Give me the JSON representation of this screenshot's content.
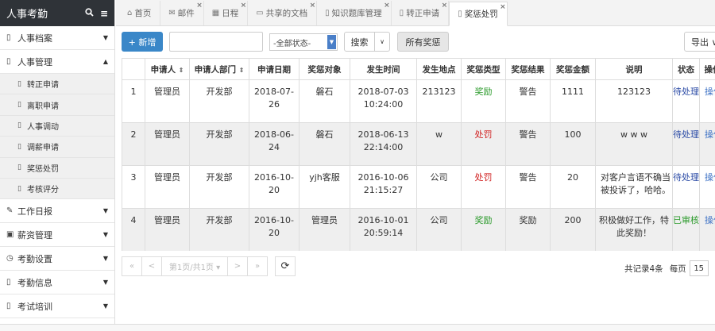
{
  "sidebar": {
    "title": "人事考勤",
    "search_icon": "search-icon",
    "menu_icon": "menu-icon",
    "items": [
      {
        "label": "人事档案",
        "icon": "bookmark-icon",
        "glyph": "▯",
        "caret": "▼"
      },
      {
        "label": "人事管理",
        "icon": "bookmark-icon",
        "glyph": "▯",
        "caret": "▲"
      },
      {
        "label": "工作日报",
        "icon": "edit-icon",
        "glyph": "✎",
        "caret": "▼"
      },
      {
        "label": "薪资管理",
        "icon": "money-icon",
        "glyph": "▣",
        "caret": "▼"
      },
      {
        "label": "考勤设置",
        "icon": "clock-icon",
        "glyph": "◷",
        "caret": "▼"
      },
      {
        "label": "考勤信息",
        "icon": "bookmark-icon",
        "glyph": "▯",
        "caret": "▼"
      },
      {
        "label": "考试培训",
        "icon": "bookmark-icon",
        "glyph": "▯",
        "caret": "▼"
      }
    ],
    "subitems": [
      "转正申请",
      "离职申请",
      "人事调动",
      "调薪申请",
      "奖惩处罚",
      "考核评分"
    ]
  },
  "tabs": [
    {
      "label": "首页",
      "glyph": "⌂"
    },
    {
      "label": "邮件",
      "glyph": "✉"
    },
    {
      "label": "日程",
      "glyph": "▦"
    },
    {
      "label": "共享的文档",
      "glyph": "▭"
    },
    {
      "label": "知识题库管理",
      "glyph": "▯"
    },
    {
      "label": "转正申请",
      "glyph": "▯"
    },
    {
      "label": "奖惩处罚",
      "glyph": "▯"
    }
  ],
  "toolbar": {
    "add_label": "+ 新增",
    "search_placeholder": "",
    "status_value": "-全部状态-",
    "search_label": "搜索",
    "search_caret": "∨",
    "all_label": "所有奖惩",
    "export_label": "导出 ∨"
  },
  "table": {
    "headers": [
      "",
      "申请人",
      "申请人部门",
      "申请日期",
      "奖惩对象",
      "发生时间",
      "发生地点",
      "奖惩类型",
      "奖惩结果",
      "奖惩金额",
      "说明",
      "状态",
      "操作"
    ],
    "rows": [
      {
        "idx": "1",
        "applicant": "管理员",
        "dept": "开发部",
        "date": "2018-07-26",
        "target": "磐石",
        "time": "2018-07-03 10:24:00",
        "place": "213123",
        "type": "奖励",
        "result": "警告",
        "amount": "1111",
        "desc": "123123",
        "status": "待处理",
        "op": "操作"
      },
      {
        "idx": "2",
        "applicant": "管理员",
        "dept": "开发部",
        "date": "2018-06-24",
        "target": "磐石",
        "time": "2018-06-13 22:14:00",
        "place": "w",
        "type": "处罚",
        "result": "警告",
        "amount": "100",
        "desc": "w w w",
        "status": "待处理",
        "op": "操作"
      },
      {
        "idx": "3",
        "applicant": "管理员",
        "dept": "开发部",
        "date": "2016-10-20",
        "target": "yjh客服",
        "time": "2016-10-06 21:15:27",
        "place": "公司",
        "type": "处罚",
        "result": "警告",
        "amount": "20",
        "desc": "对客户言语不确当被投诉了，哈哈。",
        "status": "待处理",
        "op": "操作"
      },
      {
        "idx": "4",
        "applicant": "管理员",
        "dept": "开发部",
        "date": "2016-10-20",
        "target": "管理员",
        "time": "2016-10-01 20:59:14",
        "place": "公司",
        "type": "奖励",
        "result": "奖励",
        "amount": "200",
        "desc": "积极做好工作，特此奖励！",
        "status": "已审核",
        "op": "操作"
      }
    ]
  },
  "pager": {
    "first": "«",
    "prev": "<",
    "page_label": "第1页/共1页 ▾",
    "next": ">",
    "last": "»",
    "refresh": "⟳",
    "total": "共记录4条",
    "per_page_label": "每页",
    "per_page": "15"
  },
  "colors": {
    "reward": "#2a9a2a",
    "punish": "#d02020",
    "primary": "#3a87c8",
    "header_bg": "#2f3338"
  }
}
